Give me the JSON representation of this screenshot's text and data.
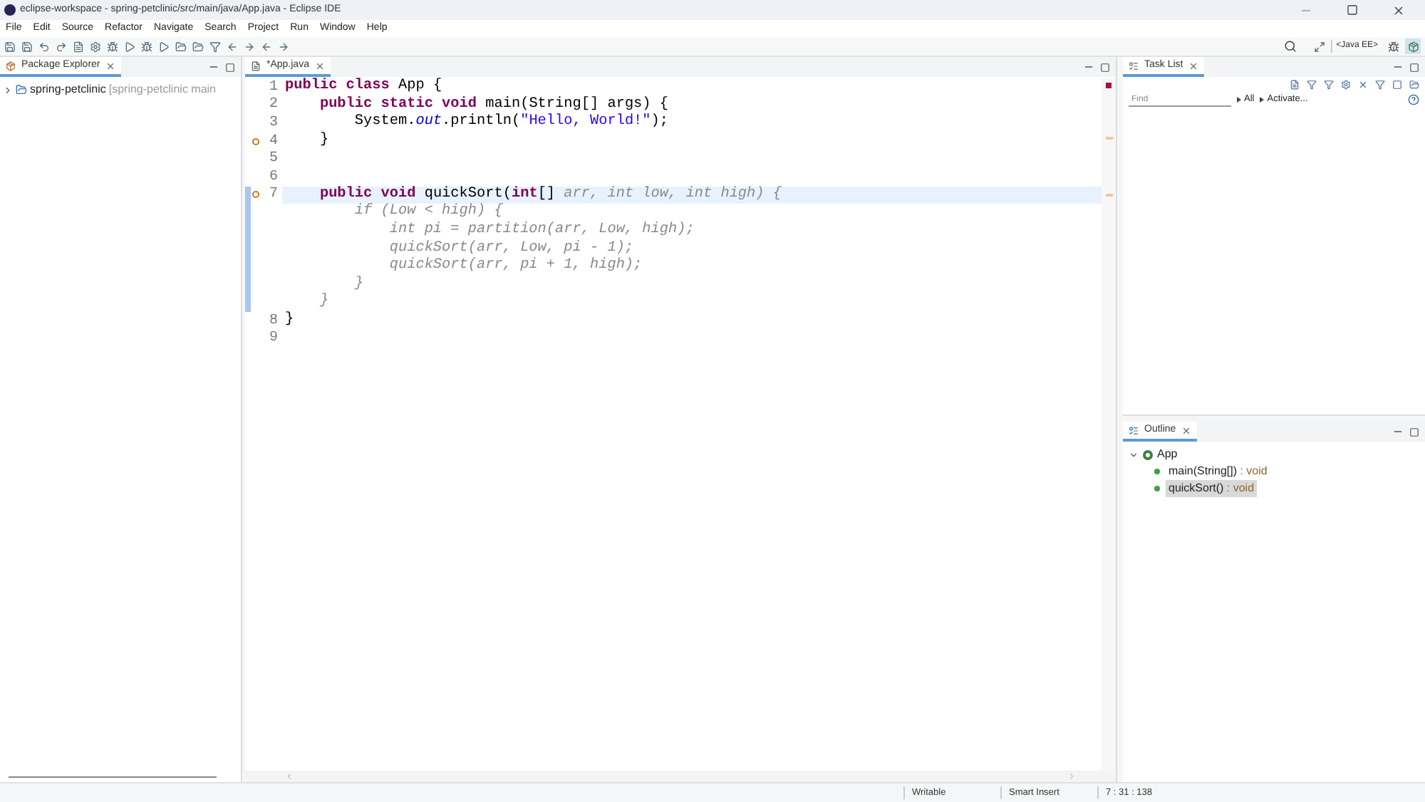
{
  "window": {
    "title": "eclipse-workspace - spring-petclinic/src/main/java/App.java - Eclipse IDE"
  },
  "menu": [
    "File",
    "Edit",
    "Source",
    "Refactor",
    "Navigate",
    "Search",
    "Project",
    "Run",
    "Window",
    "Help"
  ],
  "perspective": {
    "label": "<Java EE>"
  },
  "package_explorer": {
    "title": "Package Explorer",
    "items": [
      {
        "name": "spring-petclinic",
        "detail": "[spring-petclinic main",
        "expanded": false
      }
    ]
  },
  "editor": {
    "tab": "*App.java",
    "lines": [
      {
        "number": "1",
        "current": false,
        "warning": false,
        "segments": [
          {
            "kind": "keyword",
            "text": "public class "
          },
          {
            "kind": "plain",
            "text": "App {"
          }
        ]
      },
      {
        "number": "2",
        "current": false,
        "warning": false,
        "segments": [
          {
            "kind": "keyword",
            "text": "    public static void "
          },
          {
            "kind": "plain",
            "text": "main(String[] args) {"
          }
        ]
      },
      {
        "number": "3",
        "current": false,
        "warning": false,
        "segments": [
          {
            "kind": "plain",
            "text": "        System."
          },
          {
            "kind": "field",
            "text": "out"
          },
          {
            "kind": "plain",
            "text": ".println("
          },
          {
            "kind": "string",
            "text": "\"Hello, World!\""
          },
          {
            "kind": "plain",
            "text": ");"
          }
        ]
      },
      {
        "number": "4",
        "current": false,
        "warning": true,
        "segments": [
          {
            "kind": "plain",
            "text": "    }"
          }
        ]
      },
      {
        "number": "5",
        "current": false,
        "warning": false
      },
      {
        "number": "6",
        "current": false,
        "warning": false
      },
      {
        "number": "7",
        "current": true,
        "warning": true,
        "segments": [
          {
            "kind": "keyword",
            "text": "    public void "
          },
          {
            "kind": "plain",
            "text": "quickSort("
          },
          {
            "kind": "keyword",
            "text": "int"
          },
          {
            "kind": "plain",
            "text": "[]"
          },
          {
            "kind": "ghost",
            "text": " arr, int low, int high) {"
          }
        ]
      },
      {
        "current": false,
        "warning": false,
        "segments": [
          {
            "kind": "ghost",
            "text": "        if (Low < high) {"
          }
        ]
      },
      {
        "current": false,
        "warning": false,
        "segments": [
          {
            "kind": "ghost",
            "text": "            int pi = partition(arr, Low, high);"
          }
        ]
      },
      {
        "current": false,
        "warning": false,
        "segments": [
          {
            "kind": "ghost",
            "text": "            quickSort(arr, Low, pi - 1);"
          }
        ]
      },
      {
        "current": false,
        "warning": false,
        "segments": [
          {
            "kind": "ghost",
            "text": "            quickSort(arr, pi + 1, high);"
          }
        ]
      },
      {
        "current": false,
        "warning": false,
        "segments": [
          {
            "kind": "ghost",
            "text": "        }"
          }
        ]
      },
      {
        "current": false,
        "warning": false,
        "segments": [
          {
            "kind": "ghost",
            "text": "    }"
          }
        ]
      },
      {
        "number": "8",
        "current": false,
        "warning": false,
        "segments": [
          {
            "kind": "plain",
            "text": "}"
          }
        ]
      },
      {
        "number": "9",
        "current": false,
        "warning": false
      }
    ]
  },
  "task_list": {
    "title": "Task List",
    "search": {
      "placeholder": "Find"
    },
    "links": [
      "All",
      "Activate..."
    ]
  },
  "outline": {
    "title": "Outline",
    "root": {
      "name": "App",
      "expanded": true,
      "children": [
        {
          "name": "main(String[])",
          "type": " : void",
          "selected": false
        },
        {
          "name": "quickSort()",
          "type": " : void",
          "selected": true
        }
      ]
    }
  },
  "status_bar": [
    "Writable",
    "Smart Insert",
    "7 : 31 : 138"
  ]
}
